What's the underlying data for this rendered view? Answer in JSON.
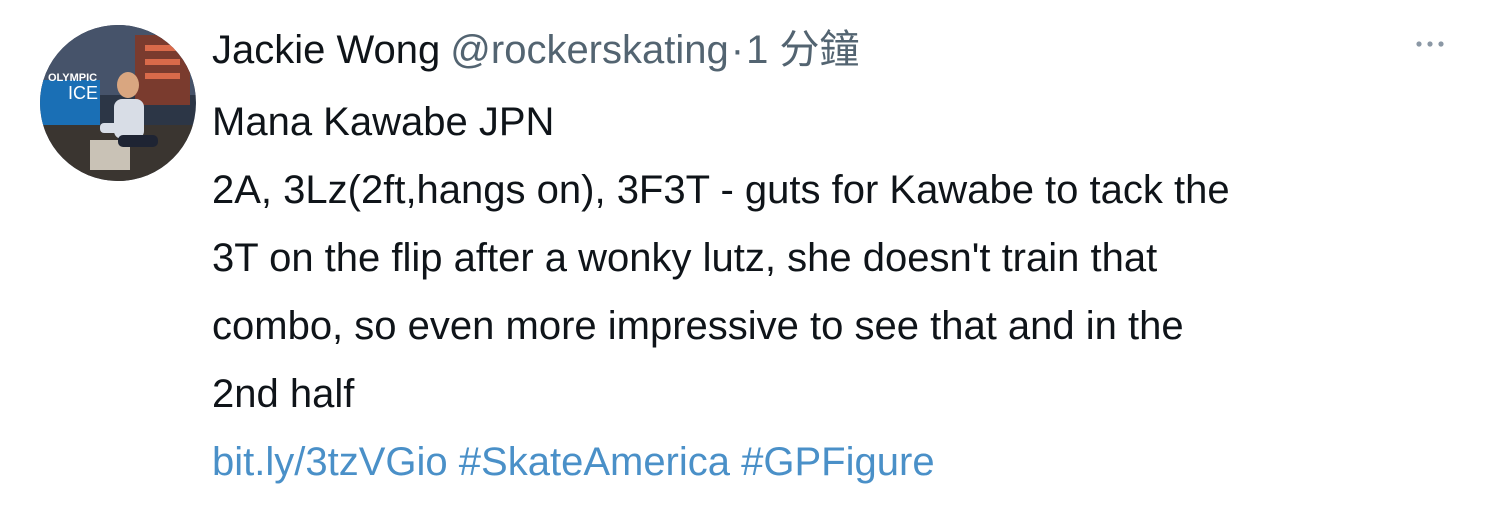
{
  "author": {
    "display_name": "Jackie Wong",
    "handle": "@rockerskating",
    "separator": "·",
    "time": "1 分鐘",
    "avatar_text": "OLYMPIC ICE"
  },
  "tweet": {
    "lines": [
      "Mana Kawabe JPN",
      "2A, 3Lz(2ft,hangs on), 3F3T - guts for Kawabe to tack the",
      "3T on the flip after a wonky lutz, she doesn't train that",
      "combo, so even more impressive to see that and in the",
      "2nd half"
    ],
    "link": "bit.ly/3tzVGio",
    "hashtags": [
      "#SkateAmerica",
      "#GPFigure"
    ]
  },
  "icons": {
    "more": "more-horizontal-icon"
  },
  "colors": {
    "text": "#0f1419",
    "secondary": "#536471",
    "link": "#4a90c8"
  }
}
